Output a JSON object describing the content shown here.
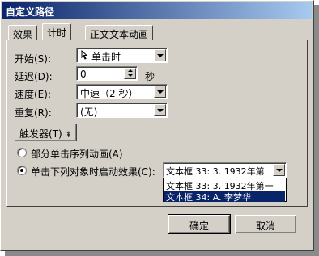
{
  "window": {
    "title": "自定义路径"
  },
  "tabs": [
    {
      "label": "效果"
    },
    {
      "label": "计时"
    },
    {
      "label": "正文文本动画"
    }
  ],
  "timing": {
    "start_label": "开始(S):",
    "start_value": "单击时",
    "start_icon": "mouse-click-icon",
    "delay_label": "延迟(D):",
    "delay_value": "0",
    "delay_unit": "秒",
    "speed_label": "速度(E):",
    "speed_value": "中速（2 秒）",
    "repeat_label": "重复(R):",
    "repeat_value": "(无)"
  },
  "triggers": {
    "button_label": "触发器(T)",
    "toggle_glyph": "⇞",
    "option_sequence": "部分单击序列动画(A)",
    "option_on_click": "单击下列对象时启动效果(C):",
    "selected_object": "文本框 33: 3. 1932年第",
    "options": [
      "文本框 33: 3. 1932年第一",
      "文本框 34: A. 李梦华"
    ],
    "selected_option_index": 1
  },
  "footer": {
    "ok_label": "确定",
    "cancel_label": "取消"
  },
  "colors": {
    "dialog_bg": "#d4d0c8",
    "titlebar_start": "#0a246a",
    "titlebar_end": "#a6caf0",
    "selection": "#0a246a"
  }
}
